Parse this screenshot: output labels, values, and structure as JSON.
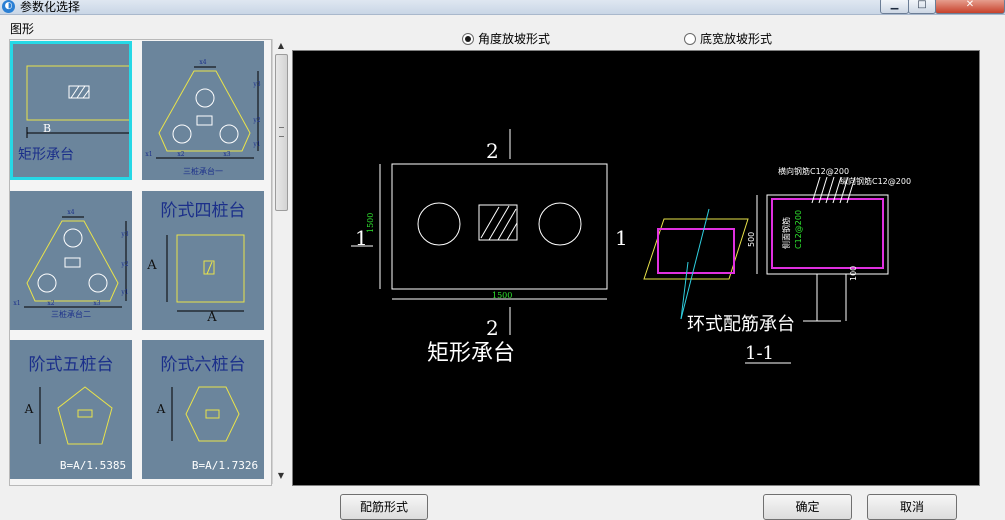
{
  "window": {
    "title": "参数化选择",
    "icon": "app-logo-icon"
  },
  "group_label": "图形",
  "thumbnails": [
    {
      "caption": "矩形承台",
      "dim": "B",
      "selected": true
    },
    {
      "caption": "三桩承台一",
      "dims": [
        "x4",
        "x1",
        "x2",
        "x3",
        "y1",
        "y2",
        "y3"
      ],
      "selected": false
    },
    {
      "caption": "三桩承台二",
      "dims": [
        "x4",
        "x1",
        "x2",
        "x3",
        "y1",
        "y2",
        "y3"
      ],
      "selected": false
    },
    {
      "caption": "阶式四桩台",
      "dim": "A",
      "selected": false
    },
    {
      "caption": "阶式五桩台",
      "dim": "A",
      "formula": "B=A/1.5385",
      "selected": false
    },
    {
      "caption": "阶式六桩台",
      "dim": "A",
      "formula": "B=A/1.7326",
      "selected": false
    }
  ],
  "mode_options": [
    {
      "label": "角度放坡形式",
      "checked": true
    },
    {
      "label": "底宽放坡形式",
      "checked": false
    }
  ],
  "preview": {
    "section_mark": "2",
    "side_mark": "1",
    "dim_width": "1500",
    "dim_height": "1500",
    "plan_title": "矩形承台",
    "rebar_horizontal": "横向钢筋C12@200",
    "rebar_vertical": "纵向钢筋C12@200",
    "rebar_side": "侧面钢筋",
    "rebar_side_spec": "C12@200",
    "height_dim": "500",
    "bottom_dim": "100",
    "ring_title": "环式配筋承台",
    "section_title": "1-1"
  },
  "buttons": {
    "rebar": "配筋形式",
    "ok": "确定",
    "cancel": "取消"
  },
  "colors": {
    "thumb_bg": "#6b859c",
    "selected_outline": "#26d8e6",
    "preview_bg": "#000000"
  }
}
